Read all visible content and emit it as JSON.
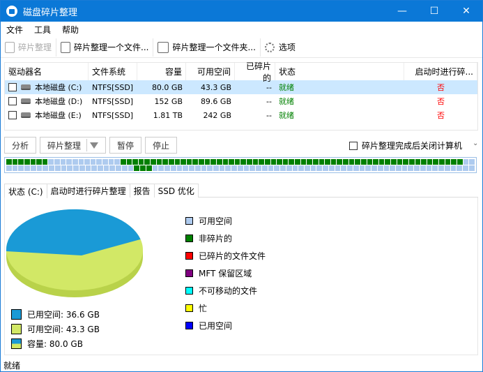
{
  "window": {
    "title": "磁盘碎片整理",
    "minimize": "—",
    "maximize": "☐",
    "close": "✕"
  },
  "menu": [
    "文件",
    "工具",
    "帮助"
  ],
  "toolbar": [
    {
      "label": "碎片整理",
      "disabled": true,
      "icon": "defrag-icon"
    },
    {
      "label": "碎片整理一个文件...",
      "icon": "file-icon"
    },
    {
      "label": "碎片整理一个文件夹...",
      "icon": "folder-icon"
    },
    {
      "label": "选项",
      "icon": "gear-icon"
    }
  ],
  "table": {
    "headers": [
      "驱动器名",
      "文件系统",
      "容量",
      "可用空间",
      "已碎片的",
      "状态",
      "启动时进行碎..."
    ],
    "rows": [
      [
        "本地磁盘 (C:)",
        "NTFS[SSD]",
        "80.0 GB",
        "43.3 GB",
        "--",
        "就绪",
        "否"
      ],
      [
        "本地磁盘 (D:)",
        "NTFS[SSD]",
        "152 GB",
        "89.6 GB",
        "--",
        "就绪",
        "否"
      ],
      [
        "本地磁盘 (E:)",
        "NTFS[SSD]",
        "1.81 TB",
        "242 GB",
        "--",
        "就绪",
        "否"
      ]
    ]
  },
  "buttons": {
    "analyze": "分析",
    "defrag": "碎片整理",
    "pause": "暂停",
    "stop": "停止"
  },
  "shutdown_label": "碎片整理完成后关闭计算机",
  "blockmap": {
    "rows": [
      "gggggggffffffffffffgggggggggggggggggggggggggggggggggggggggggggggggggggggggggff",
      "fffffffffffffffffffffgggfffffffffffffffffffffffffffffffffffffffffffffffffffff"
    ],
    "colors": {
      "g": "#008000",
      "f": "#aecbef"
    }
  },
  "tabs": [
    "状态 (C:)",
    "启动时进行碎片整理",
    "报告",
    "SSD 优化"
  ],
  "legend": [
    {
      "label": "可用空间",
      "color": "#aecbef"
    },
    {
      "label": "非碎片的",
      "color": "#008000"
    },
    {
      "label": "已碎片的文件文件",
      "color": "#ff0000"
    },
    {
      "label": "MFT 保留区域",
      "color": "#800080"
    },
    {
      "label": "不可移动的文件",
      "color": "#00ffff"
    },
    {
      "label": "忙",
      "color": "#ffff00"
    },
    {
      "label": "已用空间",
      "color": "#0000ff"
    }
  ],
  "chart_data": {
    "type": "pie",
    "values": [
      {
        "name": "已用空间",
        "value": 36.6,
        "color": "#1a9ad6"
      },
      {
        "name": "可用空间",
        "value": 43.3,
        "color": "#d2e866"
      }
    ],
    "unit": "GB"
  },
  "pie_legend": [
    "已用空间: 36.6 GB",
    "可用空间: 43.3 GB",
    "容量: 80.0 GB"
  ],
  "status": "就绪"
}
